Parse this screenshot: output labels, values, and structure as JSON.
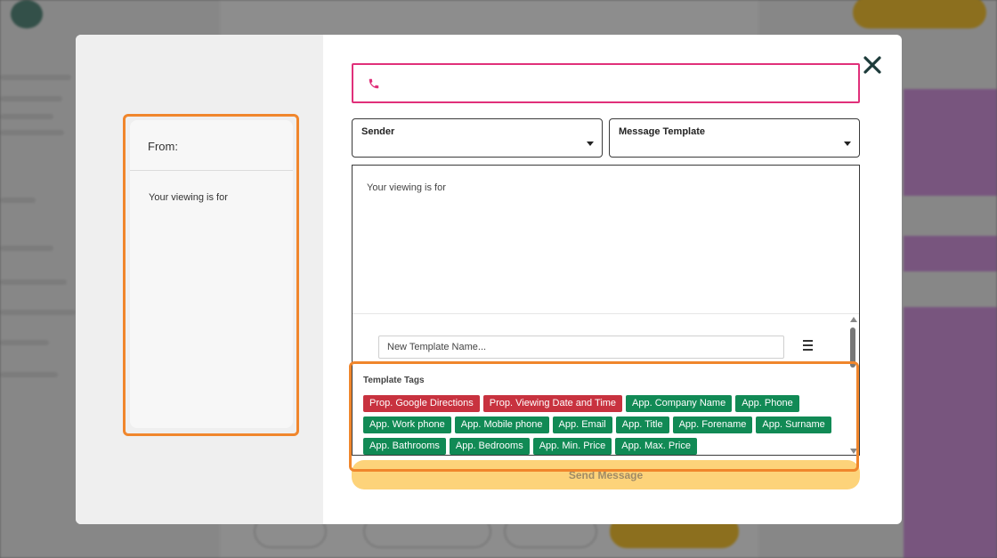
{
  "modal": {
    "phone_value": "",
    "preview": {
      "from_label": "From:",
      "body_text": "Your viewing is for"
    },
    "sender_label": "Sender",
    "template_label": "Message Template",
    "message_text": "Your viewing is for",
    "template_name_placeholder": "New Template Name...",
    "tags_title": "Template Tags",
    "tags_red": [
      "Prop. Google Directions",
      "Prop. Viewing Date and Time"
    ],
    "tags_green": [
      "App. Company Name",
      "App. Phone",
      "App. Work phone",
      "App. Mobile phone",
      "App. Email",
      "App. Title",
      "App. Forename",
      "App. Surname",
      "App. Bathrooms",
      "App. Bedrooms",
      "App. Min. Price",
      "App. Max. Price"
    ],
    "send_label": "Send Message"
  },
  "icons": {
    "phone": "phone-icon",
    "close": "close-icon",
    "menu": "hamburger-menu-icon",
    "caret": "caret-down-icon"
  },
  "colors": {
    "phone_border": "#e0307a",
    "highlight": "#f0862c",
    "tag_red": "#c8323f",
    "tag_green": "#118a55",
    "send_button": "#fdd37a"
  }
}
